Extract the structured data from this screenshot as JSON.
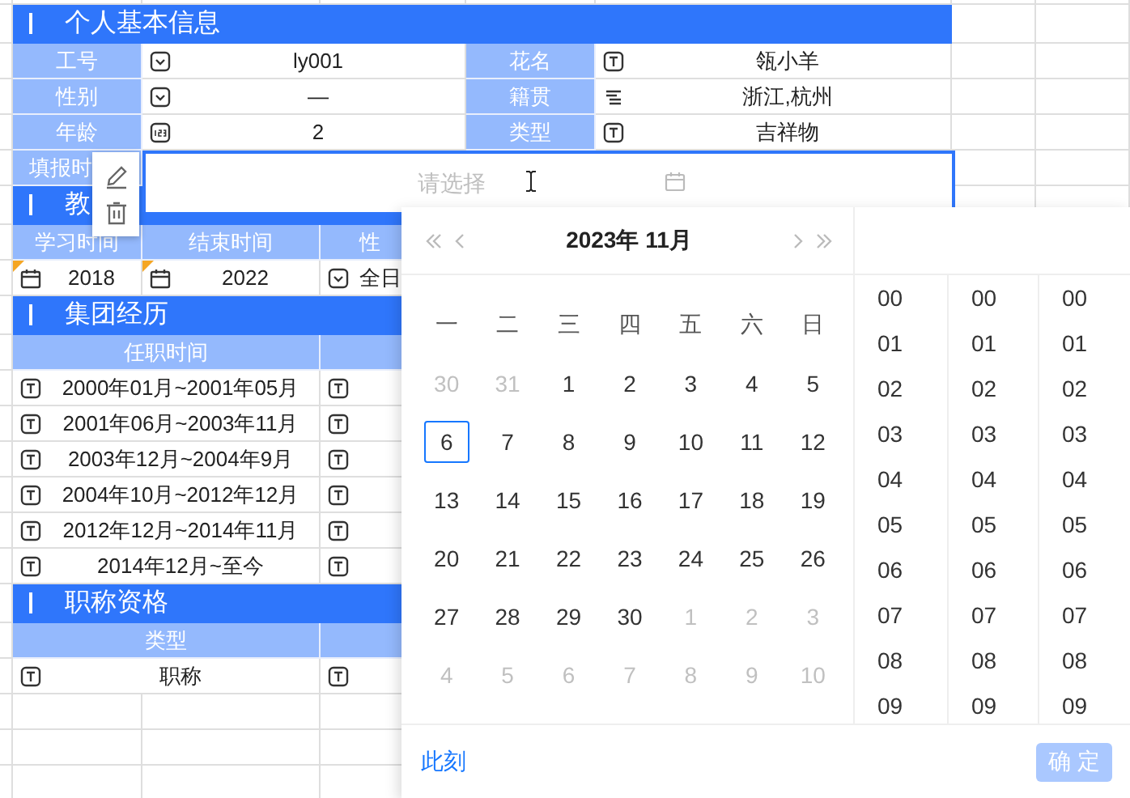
{
  "sheet": {
    "sections": [
      {
        "title": "个人基本信息",
        "kind": "form",
        "rows": [
          {
            "cells": [
              {
                "label": "工号",
                "kind": "select",
                "value": "ly001"
              },
              {
                "label": "花名",
                "kind": "text",
                "value": "瓴小羊"
              }
            ]
          },
          {
            "cells": [
              {
                "label": "性别",
                "kind": "select",
                "value": "—"
              },
              {
                "label": "籍贯",
                "kind": "cascade",
                "value": "浙江,杭州"
              }
            ]
          },
          {
            "cells": [
              {
                "label": "年龄",
                "kind": "number",
                "value": "2"
              },
              {
                "label": "类型",
                "kind": "text",
                "value": "吉祥物"
              }
            ]
          },
          {
            "cells": [
              {
                "label": "填报时"
              }
            ]
          }
        ]
      },
      {
        "title": "教",
        "kind": "table",
        "columns": [
          "学习时间",
          "结束时间",
          "性"
        ],
        "rows": [
          {
            "cells": [
              {
                "kind": "date",
                "value": "2018",
                "flagged": true
              },
              {
                "kind": "date",
                "value": "2022",
                "flagged": true
              },
              {
                "kind": "select",
                "value": "全日",
                "flagged": false
              }
            ]
          }
        ]
      },
      {
        "title": "集团经历",
        "kind": "table",
        "columns": [
          "任职时间"
        ],
        "rows": [
          {
            "cells": [
              {
                "kind": "text",
                "value": "2000年01月~2001年05月"
              },
              {
                "kind": "text"
              }
            ]
          },
          {
            "cells": [
              {
                "kind": "text",
                "value": "2001年06月~2003年11月"
              },
              {
                "kind": "text"
              }
            ]
          },
          {
            "cells": [
              {
                "kind": "text",
                "value": "2003年12月~2004年9月"
              },
              {
                "kind": "text"
              }
            ]
          },
          {
            "cells": [
              {
                "kind": "text",
                "value": "2004年10月~2012年12月"
              },
              {
                "kind": "text"
              }
            ]
          },
          {
            "cells": [
              {
                "kind": "text",
                "value": "2012年12月~2014年11月"
              },
              {
                "kind": "text"
              }
            ]
          },
          {
            "cells": [
              {
                "kind": "text",
                "value": "2014年12月~至今"
              },
              {
                "kind": "text"
              }
            ]
          }
        ]
      },
      {
        "title": "职称资格",
        "kind": "table",
        "columns": [
          "类型"
        ],
        "rows": [
          {
            "cells": [
              {
                "kind": "text",
                "value": "职称"
              },
              {
                "kind": "text"
              }
            ]
          }
        ]
      }
    ]
  },
  "date_field": {
    "placeholder": "请选择"
  },
  "picker": {
    "title": "2023年 11月",
    "weekdays": [
      "一",
      "二",
      "三",
      "四",
      "五",
      "六",
      "日"
    ],
    "days": [
      {
        "label": "30",
        "muted": true,
        "selected": false
      },
      {
        "label": "31",
        "muted": true,
        "selected": false
      },
      {
        "label": "1",
        "muted": false,
        "selected": false
      },
      {
        "label": "2",
        "muted": false,
        "selected": false
      },
      {
        "label": "3",
        "muted": false,
        "selected": false
      },
      {
        "label": "4",
        "muted": false,
        "selected": false
      },
      {
        "label": "5",
        "muted": false,
        "selected": false
      },
      {
        "label": "6",
        "muted": false,
        "selected": true
      },
      {
        "label": "7",
        "muted": false,
        "selected": false
      },
      {
        "label": "8",
        "muted": false,
        "selected": false
      },
      {
        "label": "9",
        "muted": false,
        "selected": false
      },
      {
        "label": "10",
        "muted": false,
        "selected": false
      },
      {
        "label": "11",
        "muted": false,
        "selected": false
      },
      {
        "label": "12",
        "muted": false,
        "selected": false
      },
      {
        "label": "13",
        "muted": false,
        "selected": false
      },
      {
        "label": "14",
        "muted": false,
        "selected": false
      },
      {
        "label": "15",
        "muted": false,
        "selected": false
      },
      {
        "label": "16",
        "muted": false,
        "selected": false
      },
      {
        "label": "17",
        "muted": false,
        "selected": false
      },
      {
        "label": "18",
        "muted": false,
        "selected": false
      },
      {
        "label": "19",
        "muted": false,
        "selected": false
      },
      {
        "label": "20",
        "muted": false,
        "selected": false
      },
      {
        "label": "21",
        "muted": false,
        "selected": false
      },
      {
        "label": "22",
        "muted": false,
        "selected": false
      },
      {
        "label": "23",
        "muted": false,
        "selected": false
      },
      {
        "label": "24",
        "muted": false,
        "selected": false
      },
      {
        "label": "25",
        "muted": false,
        "selected": false
      },
      {
        "label": "26",
        "muted": false,
        "selected": false
      },
      {
        "label": "27",
        "muted": false,
        "selected": false
      },
      {
        "label": "28",
        "muted": false,
        "selected": false
      },
      {
        "label": "29",
        "muted": false,
        "selected": false
      },
      {
        "label": "30",
        "muted": false,
        "selected": false
      },
      {
        "label": "1",
        "muted": true,
        "selected": false
      },
      {
        "label": "2",
        "muted": true,
        "selected": false
      },
      {
        "label": "3",
        "muted": true,
        "selected": false
      },
      {
        "label": "4",
        "muted": true,
        "selected": false
      },
      {
        "label": "5",
        "muted": true,
        "selected": false
      },
      {
        "label": "6",
        "muted": true,
        "selected": false
      },
      {
        "label": "7",
        "muted": true,
        "selected": false
      },
      {
        "label": "8",
        "muted": true,
        "selected": false
      },
      {
        "label": "9",
        "muted": true,
        "selected": false
      },
      {
        "label": "10",
        "muted": true,
        "selected": false
      }
    ],
    "time_columns": [
      [
        "00",
        "01",
        "02",
        "03",
        "04",
        "05",
        "06",
        "07",
        "08",
        "09"
      ],
      [
        "00",
        "01",
        "02",
        "03",
        "04",
        "05",
        "06",
        "07",
        "08",
        "09"
      ],
      [
        "00",
        "01",
        "02",
        "03",
        "04",
        "05",
        "06",
        "07",
        "08",
        "09"
      ]
    ],
    "now_link": "此刻",
    "confirm": {
      "label": "确 定",
      "disabled": true
    }
  }
}
